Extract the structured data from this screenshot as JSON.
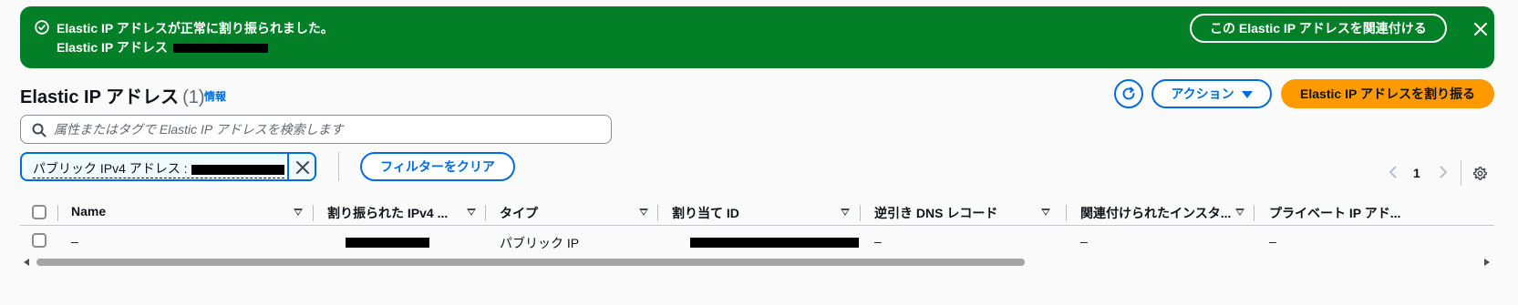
{
  "flash": {
    "title": "Elastic IP アドレスが正常に割り振られました。",
    "subtitle_prefix": "Elastic IP アドレス",
    "associate_button": "この Elastic IP アドレスを関連付ける"
  },
  "header": {
    "title": "Elastic IP アドレス",
    "count": "(1)",
    "info": "情報",
    "actions_label": "アクション",
    "allocate_button": "Elastic IP アドレスを割り振る"
  },
  "search": {
    "placeholder": "属性またはタグで Elastic IP アドレスを検索します"
  },
  "filter": {
    "token_label": "パブリック IPv4 アドレス :",
    "clear_button": "フィルターをクリア"
  },
  "pagination": {
    "current_page": "1"
  },
  "table": {
    "columns": [
      "Name",
      "割り振られた IPv4 ...",
      "タイプ",
      "割り当て ID",
      "逆引き DNS レコード",
      "関連付けられたインスタ...",
      "プライベート IP アド..."
    ],
    "rows": [
      {
        "name": "–",
        "type": "パブリック IP",
        "reverse_dns": "–",
        "instance": "–",
        "private_ip": "–"
      }
    ]
  },
  "colors": {
    "success": "#037f27",
    "primary": "#ff9900",
    "link": "#006ce0"
  },
  "icons": {
    "flash": "check-circle-icon",
    "close": "close-icon",
    "refresh": "refresh-icon",
    "search": "search-icon",
    "settings": "gear-icon"
  }
}
